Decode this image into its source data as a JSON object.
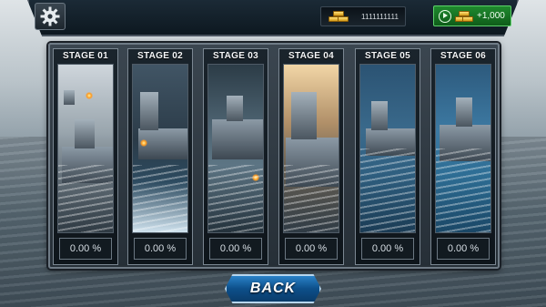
{
  "header": {
    "gold_amount": "1111111111",
    "video_reward": "+1,000"
  },
  "stages": [
    {
      "title": "STAGE 01",
      "progress": "0.00 %"
    },
    {
      "title": "STAGE 02",
      "progress": "0.00 %"
    },
    {
      "title": "STAGE 03",
      "progress": "0.00 %"
    },
    {
      "title": "STAGE 04",
      "progress": "0.00 %"
    },
    {
      "title": "STAGE 05",
      "progress": "0.00 %"
    },
    {
      "title": "STAGE 06",
      "progress": "0.00 %"
    }
  ],
  "footer": {
    "back_label": "BACK"
  },
  "colors": {
    "accent_green": "#1f8a2e",
    "accent_blue": "#0d4f8a",
    "gold": "#ffd54a"
  },
  "icons": [
    "gear-icon",
    "gold-bars-icon",
    "play-video-icon"
  ]
}
